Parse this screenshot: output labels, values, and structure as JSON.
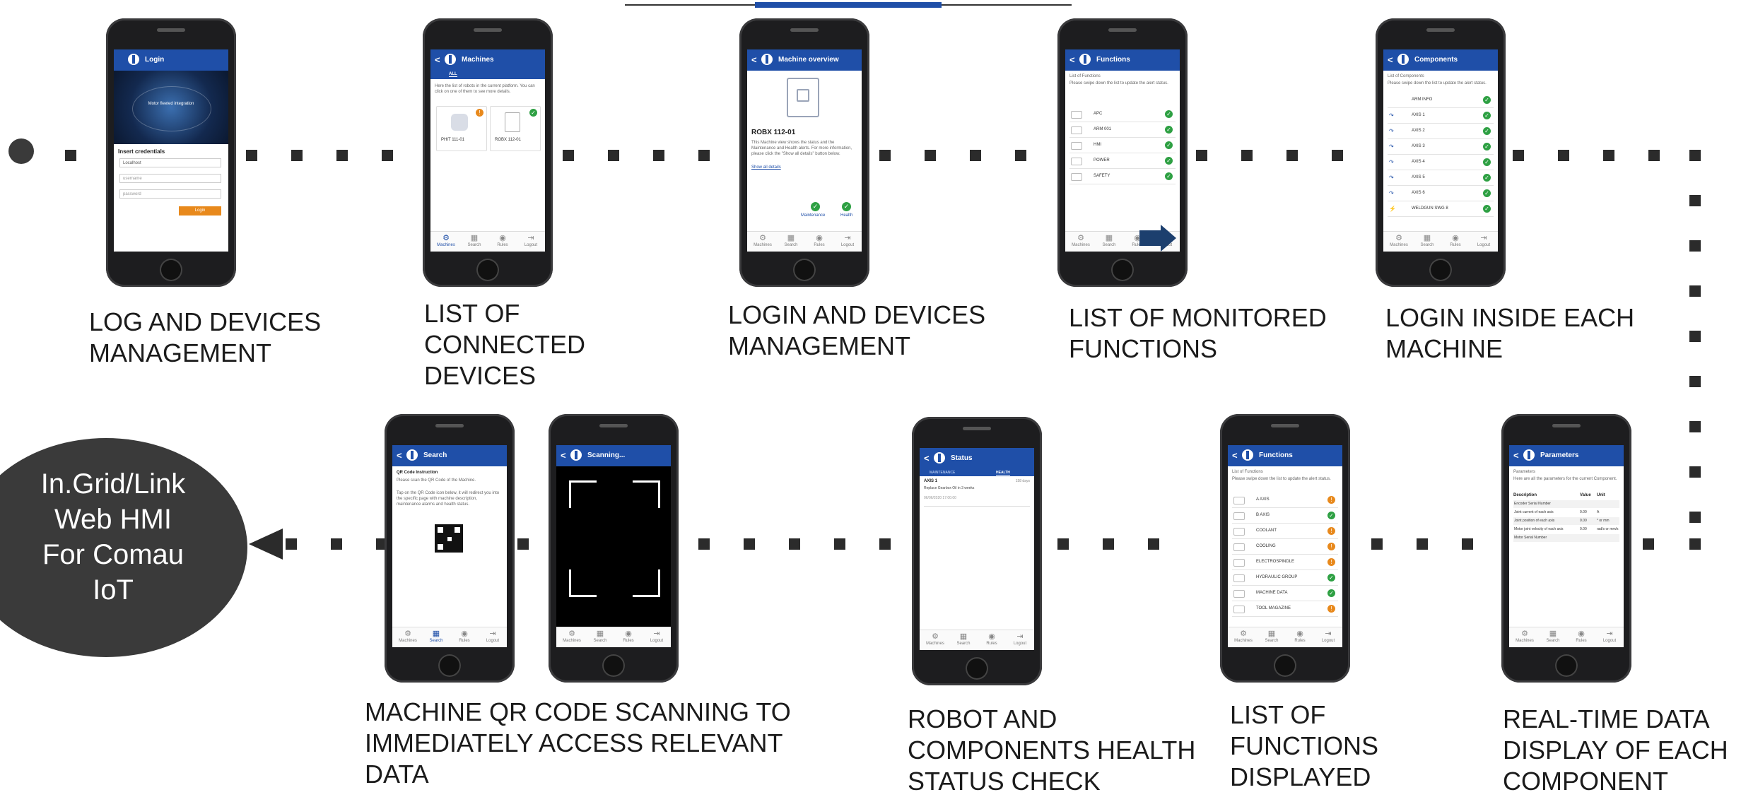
{
  "captions": {
    "c1": "LOG AND DEVICES\nMANAGEMENT",
    "c2": "LIST OF\nCONNECTED\nDEVICES",
    "c3": "LOGIN AND DEVICES\nMANAGEMENT",
    "c4": "LIST OF MONITORED\nFUNCTIONS",
    "c5": "LOGIN INSIDE EACH\nMACHINE",
    "c6": "MACHINE QR CODE SCANNING TO\nIMMEDIATELY ACCESS RELEVANT\nDATA",
    "c7": "ROBOT AND\nCOMPONENTS HEALTH\nSTATUS CHECK",
    "c8": "LIST OF\nFUNCTIONS\nDISPLAYED",
    "c9": "REAL-TIME DATA\nDISPLAY OF EACH\nCOMPONENT"
  },
  "hub": {
    "text": "In.Grid/Link\nWeb HMI\nFor Comau\nIoT"
  },
  "tabs": {
    "machines": "Machines",
    "search": "Search",
    "rules": "Rules",
    "logout": "Logout"
  },
  "phones": {
    "login": {
      "title": "Login",
      "banner": "Motor fleeted integration",
      "heading": "Insert credentials",
      "field1": "Localhost",
      "field2": "username",
      "field3": "password",
      "button": "Login"
    },
    "machines": {
      "title": "Machines",
      "tab_all": "ALL",
      "desc": "Here the list of robots in the current platform. You can click on one of them to see more details.",
      "card1": "PHIT 111-01",
      "card2": "ROBX 112-01"
    },
    "overview": {
      "title": "Machine overview",
      "name": "ROBX 112-01",
      "desc": "This Machine view shows the status and the Maintenance and Health alerts. For more information, please click the \"Show all details\" button below.",
      "link": "Show all details",
      "maint": "Maintenance",
      "health": "Health"
    },
    "functions1": {
      "title": "Functions",
      "sub": "List of Functions",
      "desc": "Please swipe down the list to update the alert status.",
      "items": [
        "APC",
        "ARM 001",
        "HMI",
        "POWER",
        "SAFETY"
      ]
    },
    "components": {
      "title": "Components",
      "sub": "List of Components",
      "desc": "Please swipe down the list to update the alert status.",
      "items": [
        "ARM INFO",
        "AXIS 1",
        "AXIS 2",
        "AXIS 3",
        "AXIS 4",
        "AXIS 5",
        "AXIS 6",
        "WELDGUN SWG 8"
      ]
    },
    "search": {
      "title": "Search",
      "heading": "QR Code Instruction",
      "desc1": "Please scan the QR Code of the Machine.",
      "desc2": "Tap on the QR Code icon below, it will redirect you into the specific page with machine description, maintenance alarms and health status."
    },
    "scanning": {
      "title": "Scanning..."
    },
    "status": {
      "title": "Status",
      "tab1": "MAINTENANCE",
      "tab2": "HEALTH",
      "axis": "AXIS 1",
      "axis_note": "Replace Gearbox Oil in 3 weeks",
      "days": "158 days",
      "date": "06/06/2020 17:00:00"
    },
    "functions2": {
      "title": "Functions",
      "sub": "List of Functions",
      "desc": "Please swipe down the list to update the alert status.",
      "items": [
        "A AXIS",
        "B AXIS",
        "COOLANT",
        "COOLING",
        "ELECTROSPINDLE",
        "HYDRAULIC GROUP",
        "MACHINE DATA",
        "TOOL MAGAZINE"
      ]
    },
    "parameters": {
      "title": "Parameters",
      "sub": "Parameters",
      "desc": "Here are all the parameters for the current Component.",
      "col1": "Description",
      "col2": "Value",
      "col3": "Unit",
      "rows": [
        [
          "Encoder Serial Number",
          "",
          ""
        ],
        [
          "Joint current of each axis",
          "0.00",
          "A"
        ],
        [
          "Joint position of each axis",
          "0.00",
          "° or mm"
        ],
        [
          "Motor joint velocity of each axis",
          "0.00",
          "rad/s or mm/s"
        ],
        [
          "Motor Serial Number",
          "",
          ""
        ]
      ]
    }
  }
}
